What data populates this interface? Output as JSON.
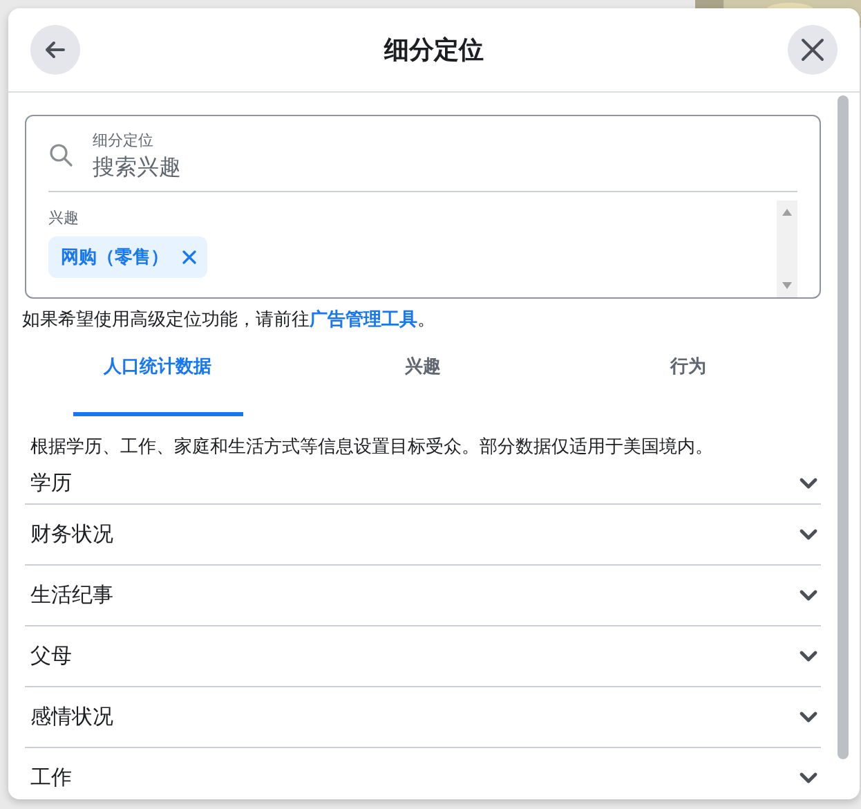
{
  "dialog": {
    "title": "细分定位"
  },
  "search": {
    "label": "细分定位",
    "placeholder": "搜索兴趣"
  },
  "selection": {
    "label": "兴趣",
    "tags": [
      {
        "label": "网购（零售）"
      }
    ]
  },
  "note": "如果希望使用高级定位功能，请前往**广告管理工具**。",
  "tabs": [
    {
      "label": "人口统计数据",
      "selected": true
    },
    {
      "label": "兴趣",
      "selected": false
    },
    {
      "label": "行为",
      "selected": false
    }
  ],
  "description": "根据学历、工作、家庭和生活方式等信息设置目标受众。部分数据仅适用于美国境内。",
  "categories": [
    {
      "label": "学历",
      "expanded": false
    },
    {
      "label": "财务状况",
      "expanded": false
    },
    {
      "label": "生活纪事",
      "expanded": false
    },
    {
      "label": "父母",
      "expanded": false
    },
    {
      "label": "感情状况",
      "expanded": false
    },
    {
      "label": "工作",
      "expanded": false
    }
  ]
}
